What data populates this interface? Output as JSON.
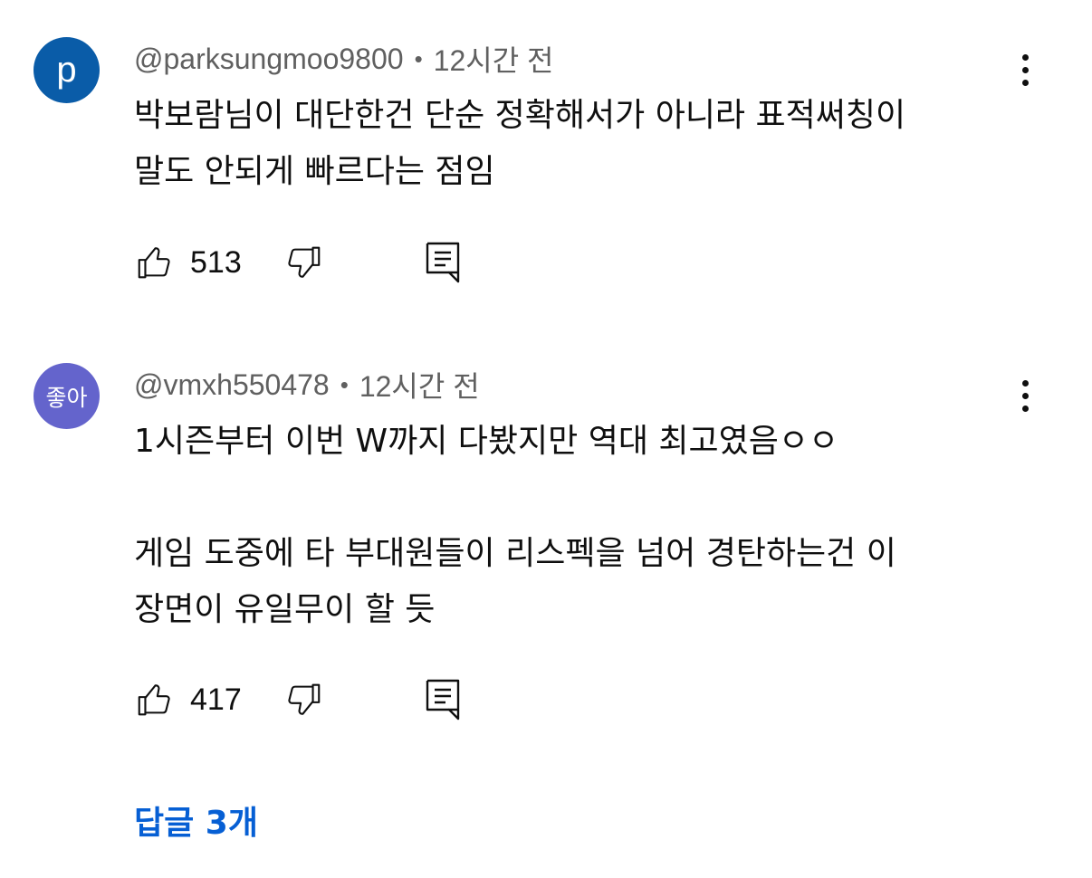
{
  "comments": [
    {
      "avatar_letter": "p",
      "avatar_color": "#0a5ca8",
      "author": "@parksungmoo9800",
      "separator": "•",
      "time": "12시간 전",
      "text": "박보람님이 대단한건 단순 정확해서가 아니라 표적써칭이\n말도 안되게 빠르다는 점임",
      "likes": "513",
      "like_icon": "thumbs-up-icon",
      "dislike_icon": "thumbs-down-icon",
      "reply_icon": "reply-icon",
      "menu_icon": "more-vert-icon"
    },
    {
      "avatar_letter": "좋아",
      "avatar_color": "#6464cc",
      "author": "@vmxh550478",
      "separator": "•",
      "time": "12시간 전",
      "text": "1시즌부터 이번 W까지 다봤지만 역대 최고였음ㅇㅇ\n\n게임 도중에 타 부대원들이 리스펙을 넘어 경탄하는건 이\n장면이 유일무이 할 듯",
      "likes": "417",
      "like_icon": "thumbs-up-icon",
      "dislike_icon": "thumbs-down-icon",
      "reply_icon": "reply-icon",
      "menu_icon": "more-vert-icon"
    }
  ],
  "replies_link": "답글 3개",
  "link_color": "#065fd4"
}
